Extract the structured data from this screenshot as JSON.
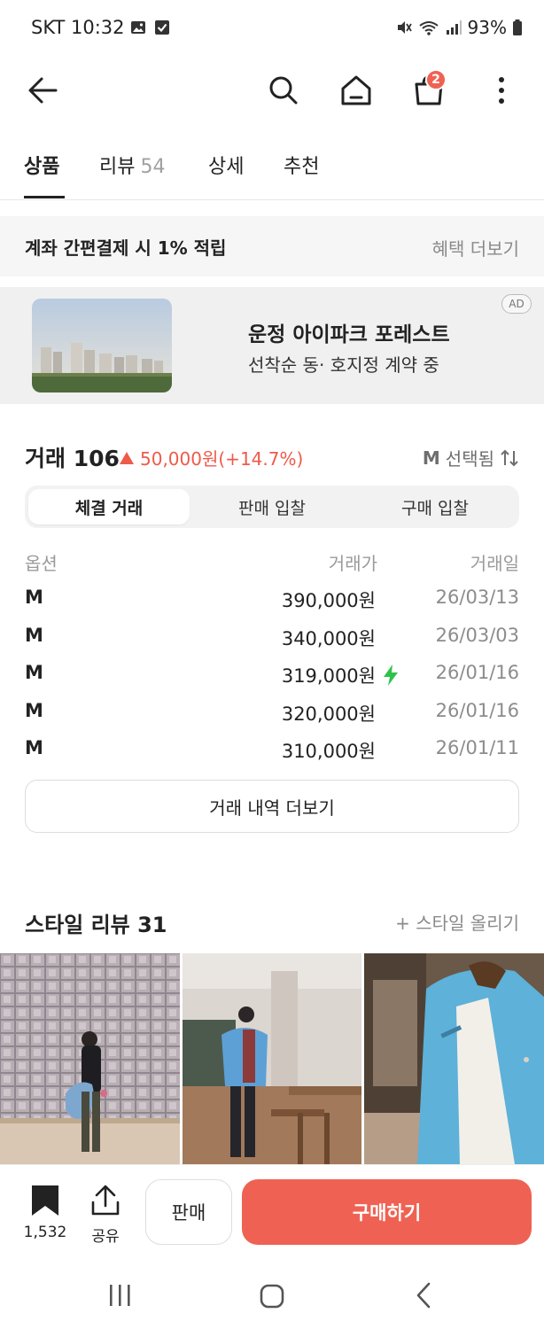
{
  "status_bar": {
    "carrier_time": "SKT 10:32",
    "battery": "93%",
    "left_icons": [
      "gallery-icon",
      "check-box-icon"
    ],
    "right_icons": [
      "mute-icon",
      "wifi-icon",
      "signal-icon",
      "battery-icon"
    ]
  },
  "header": {
    "icons": [
      "back-arrow-icon",
      "search-icon",
      "home-icon",
      "shopping-bag-icon",
      "more-vertical-icon"
    ],
    "cart_badge": "2"
  },
  "tabs": [
    {
      "label": "상품",
      "active": true
    },
    {
      "label": "리뷰",
      "count": "54"
    },
    {
      "label": "상세"
    },
    {
      "label": "추천"
    }
  ],
  "benefit": {
    "text": "계좌 간편결제 시 1% 적립",
    "link": "혜택 더보기"
  },
  "ad": {
    "title": "운정 아이파크 포레스트",
    "subtitle": "선착순 동· 호지정 계약 중",
    "badge": "AD"
  },
  "trades": {
    "title": "거래 106",
    "change": "50,000원(+14.7%)",
    "option_size": "M",
    "option_label": "선택됨",
    "segments": [
      {
        "label": "체결 거래",
        "active": true
      },
      {
        "label": "판매 입찰"
      },
      {
        "label": "구매 입찰"
      }
    ],
    "columns": [
      "옵션",
      "거래가",
      "거래일"
    ],
    "rows": [
      {
        "option": "M",
        "price": "390,000원",
        "date": "26/03/13",
        "quick": false
      },
      {
        "option": "M",
        "price": "340,000원",
        "date": "26/03/03",
        "quick": false
      },
      {
        "option": "M",
        "price": "319,000원",
        "date": "26/01/16",
        "quick": true
      },
      {
        "option": "M",
        "price": "320,000원",
        "date": "26/01/16",
        "quick": false
      },
      {
        "option": "M",
        "price": "310,000원",
        "date": "26/01/11",
        "quick": false
      }
    ],
    "more_label": "거래 내역 더보기"
  },
  "styles": {
    "title": "스타일 리뷰 31",
    "upload_label": "+ 스타일 올리기"
  },
  "bottom_bar": {
    "bookmark_count": "1,532",
    "share_label": "공유",
    "sell_label": "판매",
    "buy_label": "구매하기"
  },
  "colors": {
    "accent": "#ef6253",
    "up": "#ef5a4a",
    "quick": "#2fc24a"
  },
  "nav_icons": [
    "recent-apps-icon",
    "home-nav-icon",
    "back-nav-icon"
  ]
}
